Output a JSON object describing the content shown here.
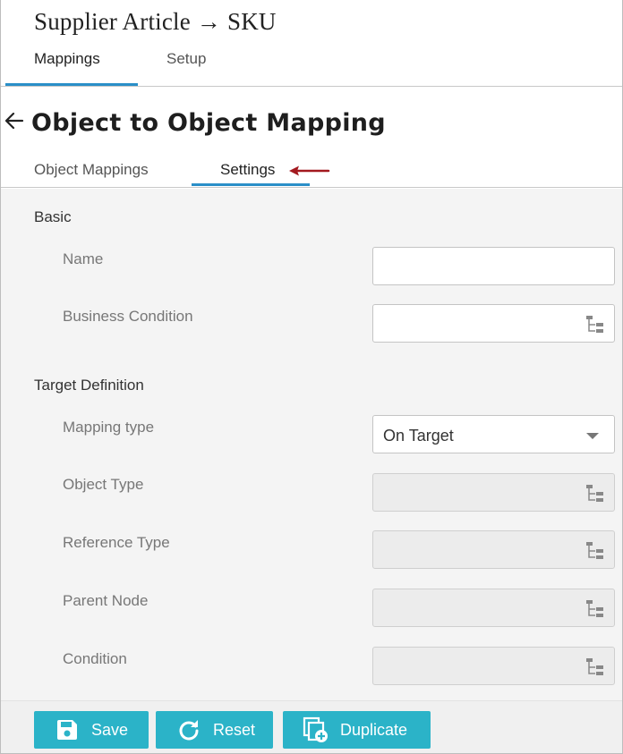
{
  "header": {
    "title": "Supplier Article → SKU",
    "tabs": [
      {
        "label": "Mappings",
        "active": true
      },
      {
        "label": "Setup",
        "active": false
      }
    ]
  },
  "subheader": {
    "title": "Object to Object Mapping",
    "tabs": [
      {
        "label": "Object Mappings",
        "active": false
      },
      {
        "label": "Settings",
        "active": true
      }
    ],
    "annotation_color": "#a3191f"
  },
  "sections": {
    "basic": {
      "title": "Basic",
      "fields": {
        "name": {
          "label": "Name",
          "value": ""
        },
        "business_condition": {
          "label": "Business Condition",
          "value": ""
        }
      }
    },
    "target": {
      "title": "Target Definition",
      "fields": {
        "mapping_type": {
          "label": "Mapping type",
          "value": "On Target"
        },
        "object_type": {
          "label": "Object Type",
          "value": ""
        },
        "reference_type": {
          "label": "Reference Type",
          "value": ""
        },
        "parent_node": {
          "label": "Parent Node",
          "value": ""
        },
        "condition": {
          "label": "Condition",
          "value": ""
        }
      }
    }
  },
  "footer": {
    "buttons": {
      "save": {
        "label": "Save",
        "icon": "floppy-disk-icon"
      },
      "reset": {
        "label": "Reset",
        "icon": "refresh-icon"
      },
      "duplicate": {
        "label": "Duplicate",
        "icon": "copy-add-icon"
      }
    }
  },
  "colors": {
    "accent": "#2a8fc8",
    "button": "#2bb3c8"
  }
}
